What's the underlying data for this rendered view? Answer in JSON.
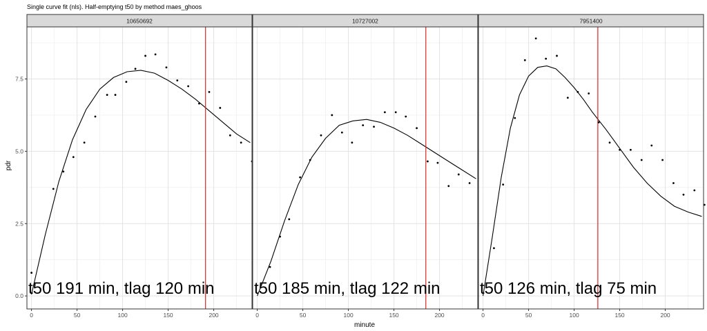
{
  "chart_data": {
    "type": "scatter",
    "title": "Single curve fit (nls). Half-emptying t50 by method maes_ghoos",
    "xlabel": "minute",
    "ylabel": "pdr",
    "xlim": [
      -5,
      242
    ],
    "ylim": [
      -0.45,
      9.3
    ],
    "x_ticks": [
      0,
      50,
      100,
      150,
      200
    ],
    "y_ticks": [
      0.0,
      2.5,
      5.0,
      7.5
    ],
    "x_tick_labels": [
      "0",
      "50",
      "100",
      "150",
      "200"
    ],
    "y_tick_labels": [
      "0.0",
      "2.5",
      "5.0",
      "7.5"
    ],
    "grid": true,
    "legend": "none",
    "colors": {
      "points": "#000000",
      "fit": "#000000",
      "t50_line": "#d62728",
      "strip_bg": "#d9d9d9",
      "grid": "#ebebeb"
    },
    "panels": [
      {
        "strip": "10650692",
        "annotation": "t50 191 min,  tlag 120 min",
        "t50": 191,
        "points": [
          [
            0,
            0.8
          ],
          [
            24,
            3.7
          ],
          [
            35,
            4.3
          ],
          [
            46,
            4.8
          ],
          [
            58,
            5.3
          ],
          [
            70,
            6.2
          ],
          [
            83,
            6.95
          ],
          [
            92,
            6.95
          ],
          [
            104,
            7.4
          ],
          [
            114,
            7.85
          ],
          [
            125,
            8.3
          ],
          [
            136,
            8.35
          ],
          [
            148,
            7.9
          ],
          [
            160,
            7.45
          ],
          [
            172,
            7.25
          ],
          [
            184,
            6.65
          ],
          [
            195,
            7.05
          ],
          [
            207,
            6.5
          ],
          [
            218,
            5.55
          ],
          [
            230,
            5.3
          ],
          [
            242,
            4.65
          ]
        ],
        "fit": [
          [
            0,
            0.05
          ],
          [
            15,
            2.1
          ],
          [
            30,
            3.95
          ],
          [
            45,
            5.4
          ],
          [
            60,
            6.45
          ],
          [
            75,
            7.15
          ],
          [
            90,
            7.55
          ],
          [
            105,
            7.75
          ],
          [
            120,
            7.8
          ],
          [
            135,
            7.7
          ],
          [
            150,
            7.45
          ],
          [
            165,
            7.15
          ],
          [
            180,
            6.8
          ],
          [
            195,
            6.4
          ],
          [
            210,
            6.0
          ],
          [
            225,
            5.6
          ],
          [
            240,
            5.3
          ]
        ]
      },
      {
        "strip": "10727002",
        "annotation": "t50 185 min,  tlag 122 min",
        "t50": 185,
        "points": [
          [
            14,
            1.0
          ],
          [
            25,
            2.05
          ],
          [
            35,
            2.65
          ],
          [
            47,
            4.1
          ],
          [
            58,
            4.7
          ],
          [
            70,
            5.55
          ],
          [
            82,
            6.25
          ],
          [
            93,
            5.65
          ],
          [
            104,
            5.3
          ],
          [
            116,
            5.9
          ],
          [
            128,
            5.85
          ],
          [
            140,
            6.35
          ],
          [
            152,
            6.35
          ],
          [
            163,
            6.2
          ],
          [
            175,
            5.8
          ],
          [
            187,
            4.65
          ],
          [
            198,
            4.6
          ],
          [
            210,
            3.8
          ],
          [
            221,
            4.2
          ],
          [
            233,
            3.9
          ]
        ],
        "fit": [
          [
            0,
            0.0
          ],
          [
            15,
            1.2
          ],
          [
            30,
            2.6
          ],
          [
            45,
            3.85
          ],
          [
            60,
            4.8
          ],
          [
            75,
            5.45
          ],
          [
            90,
            5.9
          ],
          [
            105,
            6.05
          ],
          [
            120,
            6.1
          ],
          [
            135,
            6.0
          ],
          [
            150,
            5.8
          ],
          [
            165,
            5.55
          ],
          [
            180,
            5.25
          ],
          [
            195,
            4.95
          ],
          [
            210,
            4.65
          ],
          [
            225,
            4.35
          ],
          [
            240,
            4.05
          ]
        ]
      },
      {
        "strip": "7951400",
        "annotation": "t50 126 min,  tlag 75 min",
        "t50": 126,
        "points": [
          [
            12,
            1.65
          ],
          [
            22,
            3.85
          ],
          [
            35,
            6.15
          ],
          [
            46,
            8.15
          ],
          [
            58,
            8.9
          ],
          [
            69,
            8.2
          ],
          [
            81,
            8.3
          ],
          [
            93,
            6.85
          ],
          [
            104,
            7.05
          ],
          [
            116,
            7.0
          ],
          [
            127,
            6.0
          ],
          [
            139,
            5.3
          ],
          [
            150,
            5.05
          ],
          [
            162,
            5.05
          ],
          [
            174,
            4.7
          ],
          [
            185,
            5.2
          ],
          [
            197,
            4.7
          ],
          [
            209,
            3.9
          ],
          [
            220,
            3.5
          ],
          [
            232,
            3.65
          ],
          [
            243,
            3.15
          ]
        ],
        "fit": [
          [
            0,
            0.0
          ],
          [
            10,
            2.0
          ],
          [
            20,
            4.1
          ],
          [
            30,
            5.8
          ],
          [
            40,
            6.95
          ],
          [
            50,
            7.6
          ],
          [
            60,
            7.9
          ],
          [
            70,
            7.95
          ],
          [
            80,
            7.85
          ],
          [
            90,
            7.55
          ],
          [
            100,
            7.2
          ],
          [
            110,
            6.8
          ],
          [
            120,
            6.35
          ],
          [
            135,
            5.75
          ],
          [
            150,
            5.1
          ],
          [
            165,
            4.45
          ],
          [
            180,
            3.9
          ],
          [
            195,
            3.45
          ],
          [
            210,
            3.1
          ],
          [
            225,
            2.9
          ],
          [
            240,
            2.75
          ]
        ]
      }
    ]
  }
}
